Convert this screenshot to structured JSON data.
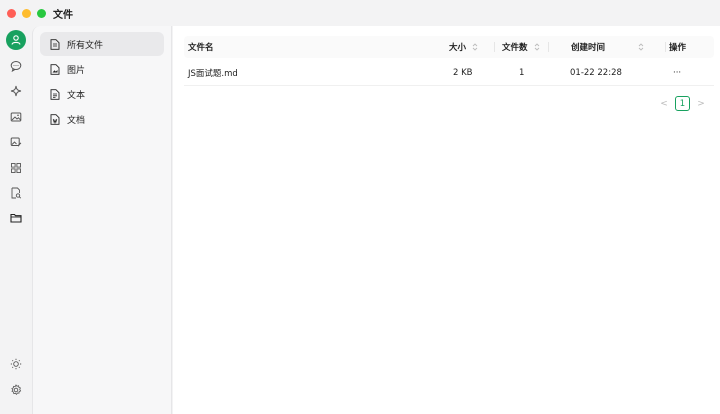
{
  "window": {
    "title": "文件"
  },
  "sidebar": {
    "items": [
      {
        "label": "所有文件",
        "active": true
      },
      {
        "label": "图片",
        "active": false
      },
      {
        "label": "文本",
        "active": false
      },
      {
        "label": "文档",
        "active": false
      }
    ]
  },
  "table": {
    "columns": {
      "name": "文件名",
      "size": "大小",
      "count": "文件数",
      "created": "创建时间",
      "action": "操作"
    },
    "rows": [
      {
        "name": "JS面试题.md",
        "size": "2 KB",
        "count": "1",
        "created": "01-22 22:28",
        "action": "···"
      }
    ]
  },
  "pagination": {
    "current": "1",
    "prev": "<",
    "next": ">"
  },
  "colors": {
    "accent": "#18a15f",
    "background": "#f3f3f4"
  }
}
